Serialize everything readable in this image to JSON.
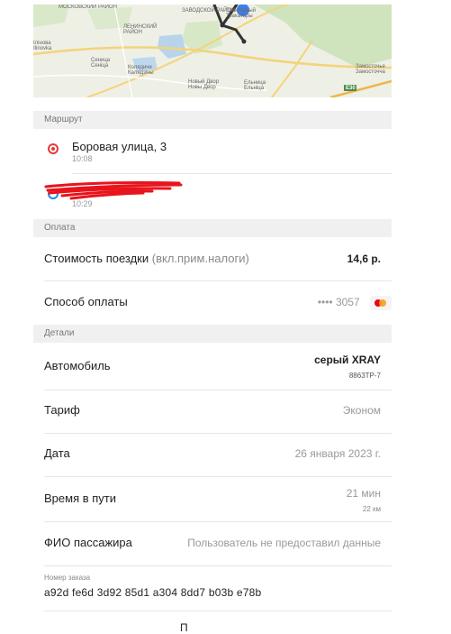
{
  "map": {
    "labels": {
      "moskovsky": "МОСКОВСКИЙ РАЙОН",
      "leninsky": "ЛЕНИНСКИЙ РАЙОН",
      "zavodskoy": "ЗАВОДСКОЙ РАЙОН",
      "ilinovka": "Ілінова Ilinovka",
      "senica": "Сеница Сеніца",
      "kolyadichi": "Колядичи Калядзічы",
      "novy_dvor": "Новый Двор Новы Двор",
      "elnitsa": "Ельница Ельніца",
      "zamostochye": "Замосточье Замосточча",
      "traktornyi": "Тракторный Тракатары",
      "road_e30": "E30"
    }
  },
  "route": {
    "header": "Маршрут",
    "from": {
      "address": "Боровая улица, 3",
      "time": "10:08"
    },
    "to": {
      "time": "10:29"
    }
  },
  "payment": {
    "header": "Оплата",
    "cost_label": "Стоимость поездки",
    "cost_note": "(вкл.прим.налоги)",
    "cost_value": "14,6 р.",
    "method_label": "Способ оплаты",
    "card_mask": "•••• 3057"
  },
  "details": {
    "header": "Детали",
    "car_label": "Автомобиль",
    "car_value": "серый XRAY",
    "car_plate": "8863TP-7",
    "tariff_label": "Тариф",
    "tariff_value": "Эконом",
    "date_label": "Дата",
    "date_value": "26 января 2023 г.",
    "duration_label": "Время в пути",
    "duration_value": "21 мин",
    "distance_value": "22 км",
    "passenger_label": "ФИО пассажира",
    "passenger_value": "Пользователь не предоставил данные",
    "order_label": "Номер заказа",
    "order_value": "a92d fe6d 3d92 85d1 a304 8dd7 b03b e78b",
    "bottom_partial": "П"
  },
  "colors": {
    "accent_red": "#e53935",
    "accent_blue": "#1e88e5",
    "header_bg": "#f0f0f0",
    "scribble": "#e8141c"
  }
}
